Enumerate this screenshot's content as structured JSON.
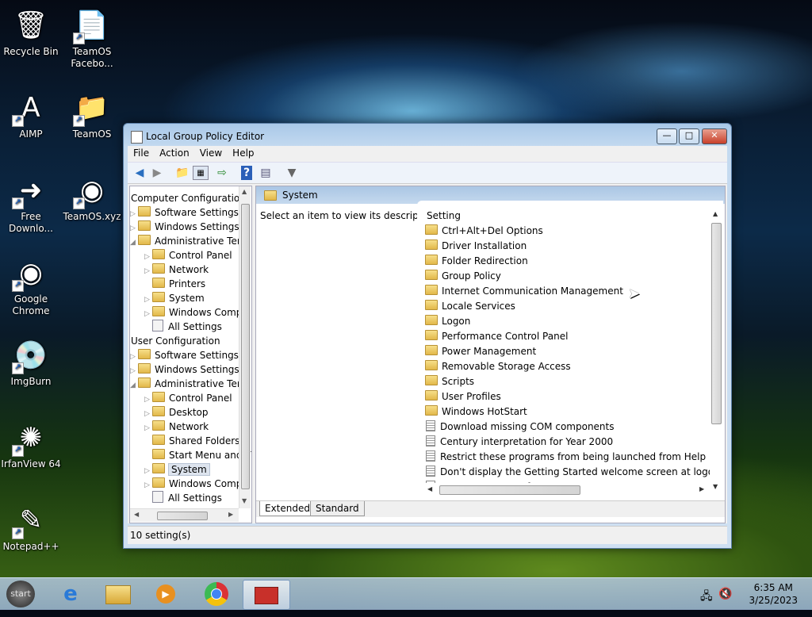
{
  "desktop": {
    "icons": [
      {
        "label": "Recycle Bin",
        "glyph": "🗑",
        "icon": "recycle-bin-icon",
        "shortcut": false
      },
      {
        "label": "TeamOS Facebo...",
        "glyph": "📄",
        "icon": "document-icon",
        "shortcut": true
      },
      {
        "label": "AIMP",
        "glyph": "A",
        "icon": "aimp-icon",
        "shortcut": true
      },
      {
        "label": "TeamOS",
        "glyph": "📁",
        "icon": "teamos-folder-icon",
        "shortcut": true
      },
      {
        "label": "Free Downlo...",
        "glyph": "➜",
        "icon": "download-icon",
        "shortcut": true
      },
      {
        "label": "TeamOS.xyz",
        "glyph": "◉",
        "icon": "chrome-icon",
        "shortcut": true
      },
      {
        "label": "Google Chrome",
        "glyph": "◉",
        "icon": "chrome-icon",
        "shortcut": true
      },
      {
        "label": "ImgBurn",
        "glyph": "💿",
        "icon": "disc-icon",
        "shortcut": true
      },
      {
        "label": "IrfanView 64",
        "glyph": "✺",
        "icon": "irfanview-icon",
        "shortcut": true
      },
      {
        "label": "Notepad++",
        "glyph": "✎",
        "icon": "notepad-icon",
        "shortcut": true
      }
    ]
  },
  "window": {
    "title": "Local Group Policy Editor",
    "menu": [
      "File",
      "Action",
      "View",
      "Help"
    ],
    "tree": [
      {
        "label": "Computer Configuratio",
        "level": 0,
        "arrow": "",
        "type": "pc"
      },
      {
        "label": "Software Settings",
        "level": 1,
        "arrow": "▷",
        "type": "folder"
      },
      {
        "label": "Windows Settings",
        "level": 1,
        "arrow": "▷",
        "type": "folder"
      },
      {
        "label": "Administrative Tem",
        "level": 1,
        "arrow": "◢",
        "type": "folder"
      },
      {
        "label": "Control Panel",
        "level": 2,
        "arrow": "▷",
        "type": "folder"
      },
      {
        "label": "Network",
        "level": 2,
        "arrow": "▷",
        "type": "folder"
      },
      {
        "label": "Printers",
        "level": 2,
        "arrow": "",
        "type": "folder"
      },
      {
        "label": "System",
        "level": 2,
        "arrow": "▷",
        "type": "folder"
      },
      {
        "label": "Windows Comp",
        "level": 2,
        "arrow": "▷",
        "type": "folder"
      },
      {
        "label": "All Settings",
        "level": 2,
        "arrow": "",
        "type": "settings"
      },
      {
        "label": "User Configuration",
        "level": 0,
        "arrow": "",
        "type": "user"
      },
      {
        "label": "Software Settings",
        "level": 1,
        "arrow": "▷",
        "type": "folder"
      },
      {
        "label": "Windows Settings",
        "level": 1,
        "arrow": "▷",
        "type": "folder"
      },
      {
        "label": "Administrative Tem",
        "level": 1,
        "arrow": "◢",
        "type": "folder"
      },
      {
        "label": "Control Panel",
        "level": 2,
        "arrow": "▷",
        "type": "folder"
      },
      {
        "label": "Desktop",
        "level": 2,
        "arrow": "▷",
        "type": "folder"
      },
      {
        "label": "Network",
        "level": 2,
        "arrow": "▷",
        "type": "folder"
      },
      {
        "label": "Shared Folders",
        "level": 2,
        "arrow": "",
        "type": "folder"
      },
      {
        "label": "Start Menu and T",
        "level": 2,
        "arrow": "",
        "type": "folder"
      },
      {
        "label": "System",
        "level": 2,
        "arrow": "▷",
        "type": "folder",
        "selected": true
      },
      {
        "label": "Windows Comp",
        "level": 2,
        "arrow": "▷",
        "type": "folder"
      },
      {
        "label": "All Settings",
        "level": 2,
        "arrow": "",
        "type": "settings"
      }
    ],
    "header_title": "System",
    "description": "Select an item to view its description.",
    "column_header": "Setting",
    "items": [
      {
        "label": "Ctrl+Alt+Del Options",
        "type": "folder"
      },
      {
        "label": "Driver Installation",
        "type": "folder"
      },
      {
        "label": "Folder Redirection",
        "type": "folder"
      },
      {
        "label": "Group Policy",
        "type": "folder"
      },
      {
        "label": "Internet Communication Management",
        "type": "folder"
      },
      {
        "label": "Locale Services",
        "type": "folder"
      },
      {
        "label": "Logon",
        "type": "folder"
      },
      {
        "label": "Performance Control Panel",
        "type": "folder"
      },
      {
        "label": "Power Management",
        "type": "folder"
      },
      {
        "label": "Removable Storage Access",
        "type": "folder"
      },
      {
        "label": "Scripts",
        "type": "folder"
      },
      {
        "label": "User Profiles",
        "type": "folder"
      },
      {
        "label": "Windows HotStart",
        "type": "folder"
      },
      {
        "label": "Download missing COM components",
        "type": "setting"
      },
      {
        "label": "Century interpretation for Year 2000",
        "type": "setting"
      },
      {
        "label": "Restrict these programs from being launched from Help",
        "type": "setting"
      },
      {
        "label": "Don't display the Getting Started welcome screen at logon",
        "type": "setting"
      },
      {
        "label": "Custom User Interface",
        "type": "setting"
      }
    ],
    "tabs": [
      "Extended",
      "Standard"
    ],
    "status": "10 setting(s)"
  },
  "taskbar": {
    "start_label": "start",
    "time": "6:35 AM",
    "date": "3/25/2023"
  }
}
